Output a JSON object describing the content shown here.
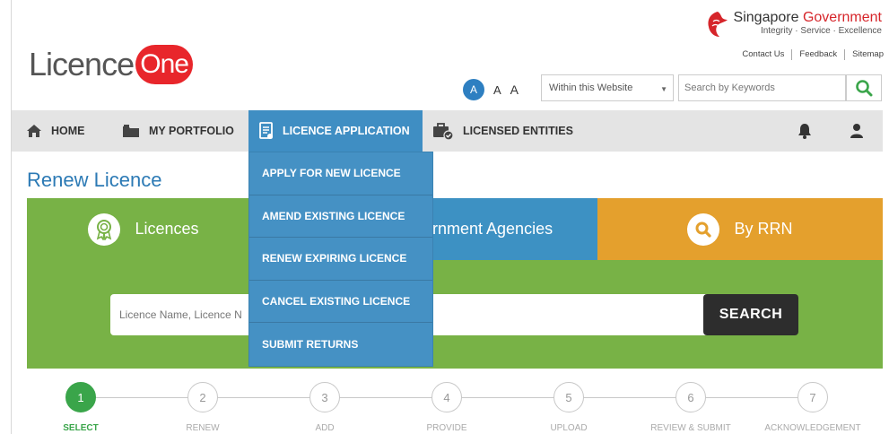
{
  "logo": {
    "text": "Licence",
    "badge": "One"
  },
  "gov": {
    "title_part1": "Singapore",
    "title_part2": "Government",
    "tagline": "Integrity · Service · Excellence"
  },
  "util_links": [
    "Contact Us",
    "Feedback",
    "Sitemap"
  ],
  "font_size": {
    "active": "A",
    "medium": "A",
    "large": "A"
  },
  "search": {
    "scope": "Within this Website",
    "placeholder": "Search by Keywords"
  },
  "nav": {
    "home": "HOME",
    "portfolio": "MY PORTFOLIO",
    "licence_application": "LICENCE APPLICATION",
    "licensed_entities": "LICENSED ENTITIES"
  },
  "dropdown": [
    "APPLY FOR NEW LICENCE",
    "AMEND EXISTING LICENCE",
    "RENEW EXPIRING LICENCE",
    "CANCEL EXISTING LICENCE",
    "SUBMIT RETURNS"
  ],
  "page_title": "Renew Licence",
  "tabs": {
    "licences": "Licences",
    "agencies": "rnment Agencies",
    "rrn": "By RRN"
  },
  "licence_search": {
    "placeholder": "Licence Name, Licence N",
    "button": "SEARCH"
  },
  "steps": [
    {
      "num": "1",
      "label": "SELECT"
    },
    {
      "num": "2",
      "label": "RENEW"
    },
    {
      "num": "3",
      "label": "ADD"
    },
    {
      "num": "4",
      "label": "PROVIDE"
    },
    {
      "num": "5",
      "label": "UPLOAD"
    },
    {
      "num": "6",
      "label": "REVIEW & SUBMIT"
    },
    {
      "num": "7",
      "label": "ACKNOWLEDGEMENT"
    }
  ],
  "colors": {
    "primary_blue": "#3f8ec3",
    "green": "#78b246",
    "orange": "#e4a02d",
    "red": "#e8262b",
    "step_green": "#3aa54a"
  }
}
